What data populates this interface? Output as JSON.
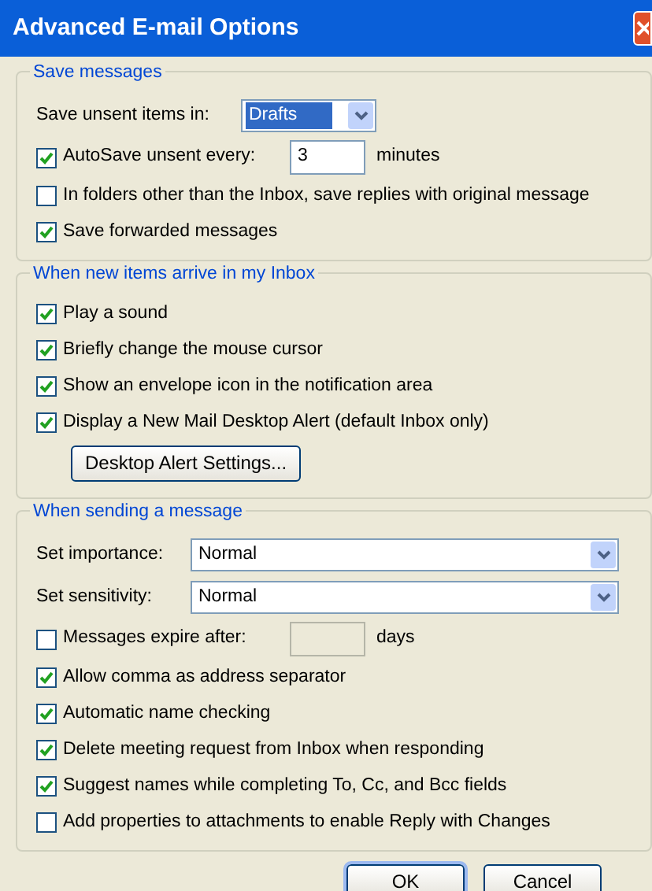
{
  "window": {
    "title": "Advanced E-mail Options"
  },
  "groups": [
    {
      "title": "Save messages",
      "rows": [
        {
          "kind": "select",
          "label": "Save unsent items in:",
          "value": "Drafts",
          "highlighted": true,
          "wide": false
        },
        {
          "kind": "checkbox_input",
          "label": "AutoSave unsent every:",
          "checked": true,
          "field": {
            "value": "3",
            "disabled": false
          },
          "suffix": "minutes"
        },
        {
          "kind": "checkbox",
          "label": "In folders other than the Inbox, save replies with original message",
          "checked": false
        },
        {
          "kind": "checkbox",
          "label": "Save forwarded messages",
          "checked": true
        }
      ]
    },
    {
      "title": "When new items arrive in my Inbox",
      "rows": [
        {
          "kind": "checkbox",
          "label": "Play a sound",
          "checked": true
        },
        {
          "kind": "checkbox",
          "label": "Briefly change the mouse cursor",
          "checked": true
        },
        {
          "kind": "checkbox",
          "label": "Show an envelope icon in the notification area",
          "checked": true
        },
        {
          "kind": "checkbox",
          "label": "Display a New Mail Desktop Alert (default Inbox only)",
          "checked": true
        },
        {
          "kind": "button",
          "label": "Desktop Alert Settings..."
        }
      ]
    },
    {
      "title": "When sending a message",
      "rows": [
        {
          "kind": "select",
          "label": "Set importance:",
          "value": "Normal",
          "highlighted": false,
          "wide": true
        },
        {
          "kind": "select",
          "label": "Set sensitivity:",
          "value": "Normal",
          "highlighted": false,
          "wide": true
        },
        {
          "kind": "checkbox_input",
          "label": "Messages expire after:",
          "checked": false,
          "field": {
            "disabled": true
          },
          "suffix": "days"
        },
        {
          "kind": "checkbox",
          "label": "Allow comma as address separator",
          "checked": true
        },
        {
          "kind": "checkbox",
          "label": "Automatic name checking",
          "checked": true
        },
        {
          "kind": "checkbox",
          "label": "Delete meeting request from Inbox when responding",
          "checked": true
        },
        {
          "kind": "checkbox",
          "label": "Suggest names while completing To, Cc, and Bcc fields",
          "checked": true
        },
        {
          "kind": "checkbox",
          "label": "Add properties to attachments to enable Reply with Changes",
          "checked": false
        }
      ]
    }
  ],
  "buttons": [
    {
      "label": "OK",
      "default": true
    },
    {
      "label": "Cancel",
      "default": false
    }
  ]
}
